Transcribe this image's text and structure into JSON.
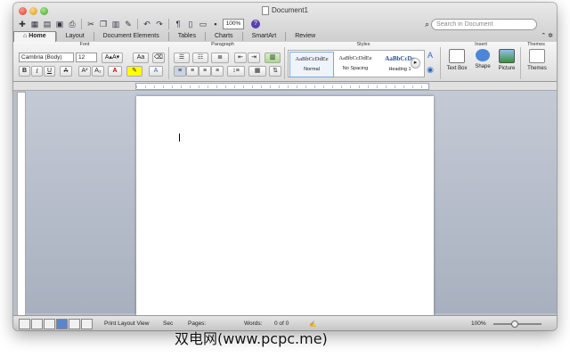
{
  "window": {
    "title": "Document1"
  },
  "search": {
    "placeholder": "Search in Document"
  },
  "toolbar": {
    "zoom": "100%",
    "help_label": "?"
  },
  "tabs": [
    {
      "label": "Home"
    },
    {
      "label": "Layout"
    },
    {
      "label": "Document Elements"
    },
    {
      "label": "Tables"
    },
    {
      "label": "Charts"
    },
    {
      "label": "SmartArt"
    },
    {
      "label": "Review"
    }
  ],
  "ribbon": {
    "groups": {
      "font": "Font",
      "paragraph": "Paragraph",
      "styles": "Styles",
      "insert": "Insert",
      "themes": "Themes"
    },
    "font_name": "Cambria (Body)",
    "font_size": "12",
    "format_buttons": {
      "bold": "B",
      "italic": "I",
      "underline": "U"
    },
    "styles": [
      {
        "preview": "AaBbCcDdEe",
        "name": "Normal"
      },
      {
        "preview": "AaBbCcDdEe",
        "name": "No Spacing"
      },
      {
        "preview": "AaBbCcDc",
        "name": "Heading 1"
      }
    ],
    "insert_buttons": [
      {
        "label": "Text Box"
      },
      {
        "label": "Shape"
      },
      {
        "label": "Picture"
      }
    ],
    "themes_button": "Themes"
  },
  "statusbar": {
    "view": "Print Layout View",
    "sec": "Sec",
    "pages": "Pages:",
    "words_label": "Words:",
    "words_value": "0 of 0",
    "zoom": "100%"
  },
  "watermark": "双电网(www.pcpc.me)",
  "colors": {
    "accent": "#5a86c8",
    "canvas": "#b4bbc8"
  }
}
